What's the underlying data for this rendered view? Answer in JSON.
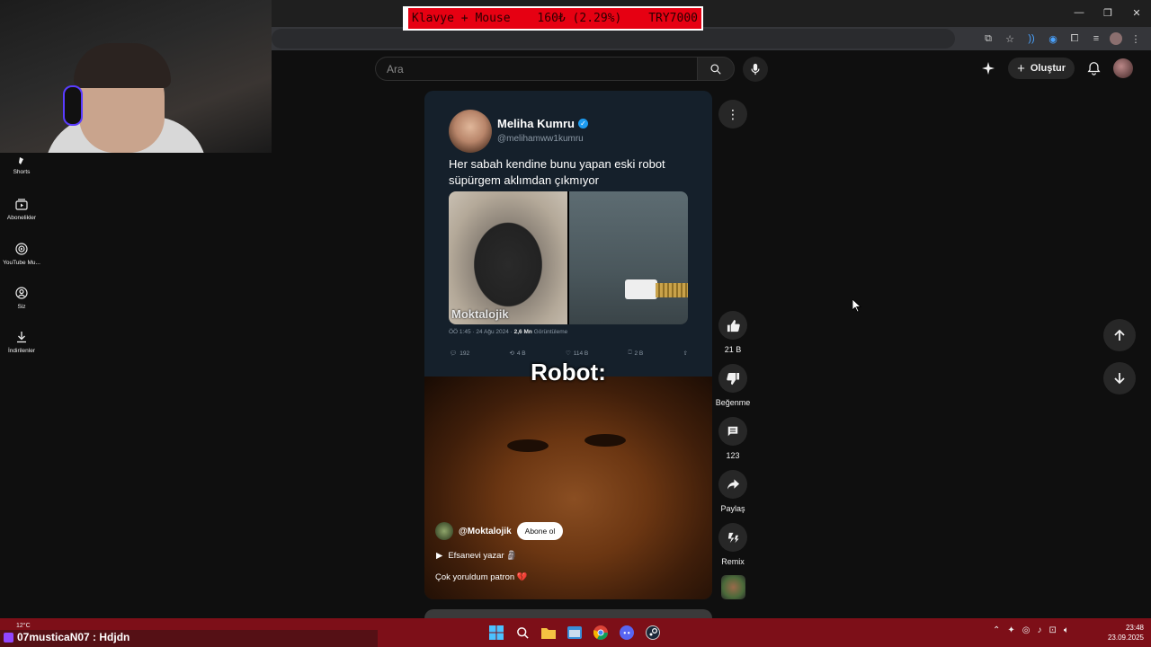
{
  "window": {
    "minimize": "—",
    "maximize": "❐",
    "close": "✕"
  },
  "ticker": {
    "label": "Klavye + Mouse",
    "amount": "160₺ (2.29%)",
    "goal": "TRY7000"
  },
  "search": {
    "placeholder": "Ara"
  },
  "header": {
    "create_label": "Oluştur"
  },
  "sidebar": {
    "items": [
      {
        "label": "Shorts",
        "icon": "shorts-icon"
      },
      {
        "label": "Abonelikler",
        "icon": "subscriptions-icon"
      },
      {
        "label": "YouTube Mu...",
        "icon": "youtube-music-icon"
      },
      {
        "label": "Siz",
        "icon": "user-icon"
      },
      {
        "label": "İndirilenler",
        "icon": "download-icon"
      }
    ]
  },
  "short": {
    "tweet": {
      "name": "Meliha Kumru",
      "handle": "@melihamww1kumru",
      "text": "Her sabah kendine bunu yapan eski robot süpürgem aklımdan çıkmıyor",
      "watermark": "Moktalojik",
      "meta_time": "ÖÖ 1:45 · 24 Ağu 2024 · ",
      "meta_views": "2,6 Mn",
      "meta_views_label": " Görüntüleme",
      "replies": "192",
      "retweets": "4 B",
      "likes": "114 B",
      "bookmarks": "2 B"
    },
    "caption": "Robot:",
    "channel": "@Moktalojik",
    "subscribe_label": "Abone ol",
    "playlist": "Efsanevi yazar 🗿",
    "description": "Çok yoruldum patron 💔"
  },
  "actions": {
    "likes": "21 B",
    "dislike_label": "Beğenme",
    "comments": "123",
    "share_label": "Paylaş",
    "remix_label": "Remix"
  },
  "taskbar": {
    "weather": "12°C",
    "chat_message": "07musticaN07 : Hdjdn",
    "time": "23:48",
    "date": "23.09.2025"
  }
}
